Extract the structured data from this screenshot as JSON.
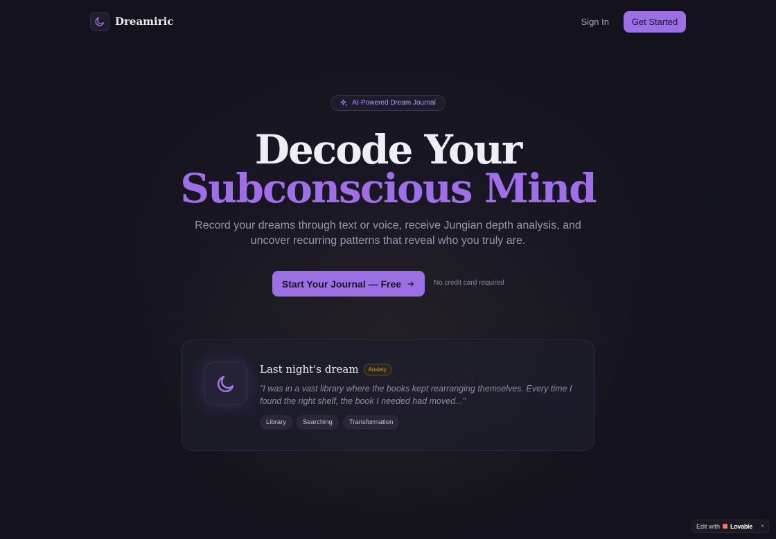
{
  "nav": {
    "brand": "Dreamiric",
    "sign_in": "Sign In",
    "get_started": "Get Started"
  },
  "hero": {
    "badge": "AI-Powered Dream Journal",
    "title_line1": "Decode Your",
    "title_line2": "Subconscious Mind",
    "subtitle": "Record your dreams through text or voice, receive Jungian depth analysis, and uncover recurring patterns that reveal who you truly are.",
    "cta": "Start Your Journal — Free",
    "cta_note": "No credit card required"
  },
  "preview_card": {
    "title": "Last night's dream",
    "mood": "Anxiety",
    "quote": "\"I was in a vast library where the books kept rearranging themselves. Every time I found the right shelf, the book I needed had moved...\"",
    "tags": [
      "Library",
      "Searching",
      "Transformation"
    ]
  },
  "lovable_badge": {
    "prefix": "Edit with",
    "name": "Lovable",
    "close": "×"
  },
  "colors": {
    "background": "#14131d",
    "accent": "#9c6fe4",
    "accent_text": "#a06fe8",
    "mood_badge": "#d59b52"
  },
  "icons": {
    "logo": "moon-icon",
    "badge": "sparkles-icon",
    "cta": "arrow-right-icon",
    "card": "moon-icon"
  }
}
